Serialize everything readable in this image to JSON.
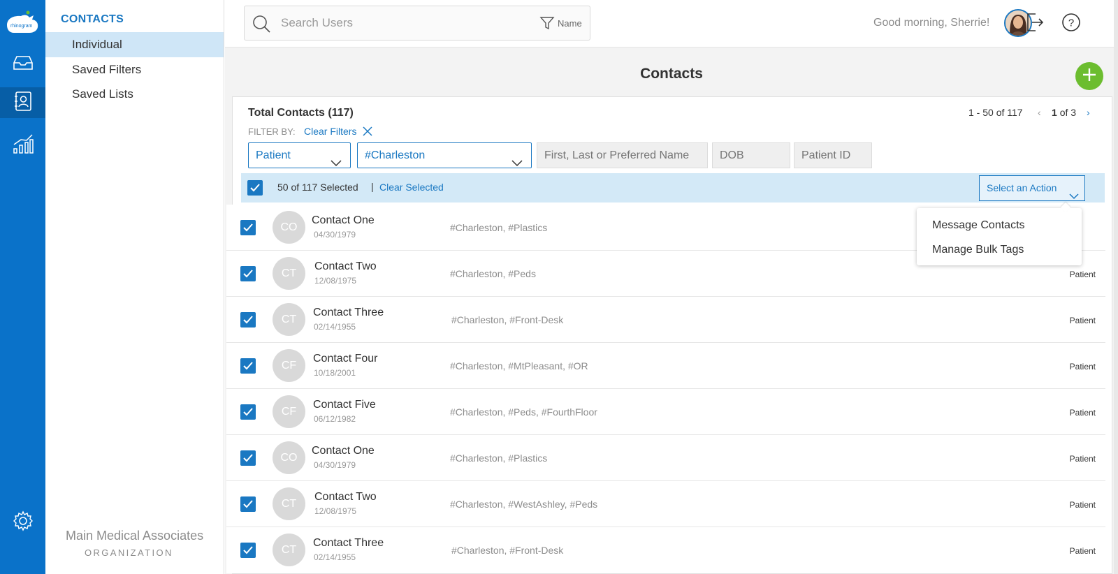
{
  "app": {
    "logo_text": "rhinogram"
  },
  "rail": {
    "items": [
      {
        "icon": "inbox-icon"
      },
      {
        "icon": "contacts-icon"
      },
      {
        "icon": "analytics-icon"
      }
    ],
    "settings_icon": "gear-icon"
  },
  "sidebar": {
    "title": "CONTACTS",
    "items": [
      {
        "label": "Individual",
        "active": true
      },
      {
        "label": "Saved Filters",
        "active": false
      },
      {
        "label": "Saved Lists",
        "active": false
      }
    ],
    "org_name": "Main Medical Associates",
    "org_sub": "ORGANIZATION"
  },
  "header": {
    "search_placeholder": "Search Users",
    "filter_label": "Name",
    "greeting": "Good morning, Sherrie!"
  },
  "main": {
    "title": "Contacts",
    "total_label": "Total Contacts (117)",
    "pager": {
      "range": "1 - 50 of 117",
      "page": "1",
      "of": "of 3"
    },
    "filter_by": "FILTER BY:",
    "clear_filters": "Clear Filters",
    "filters": {
      "type": "Patient",
      "tag": "#Charleston",
      "name_placeholder": "First, Last or Preferred Name",
      "dob_placeholder": "DOB",
      "id_placeholder": "Patient ID"
    },
    "selection": {
      "count": "50 of 117  Selected",
      "separator": "|",
      "clear": "Clear Selected",
      "action": "Select an Action"
    },
    "action_menu": [
      "Message Contacts",
      "Manage Bulk Tags"
    ],
    "rows": [
      {
        "initials": "CO",
        "name": "Contact One",
        "dob": "04/30/1979",
        "tags": "#Charleston, #Plastics",
        "type": ""
      },
      {
        "initials": "CT",
        "name": "Contact Two",
        "dob": "12/08/1975",
        "tags": "#Charleston, #Peds",
        "type": "Patient"
      },
      {
        "initials": "CT",
        "name": "Contact Three",
        "dob": "02/14/1955",
        "tags": "#Charleston, #Front-Desk",
        "type": "Patient"
      },
      {
        "initials": "CF",
        "name": "Contact Four",
        "dob": "10/18/2001",
        "tags": "#Charleston, #MtPleasant, #OR",
        "type": "Patient"
      },
      {
        "initials": "CF",
        "name": "Contact Five",
        "dob": "06/12/1982",
        "tags": "#Charleston, #Peds, #FourthFloor",
        "type": "Patient"
      },
      {
        "initials": "CO",
        "name": "Contact One",
        "dob": "04/30/1979",
        "tags": "#Charleston, #Plastics",
        "type": "Patient"
      },
      {
        "initials": "CT",
        "name": "Contact Two",
        "dob": "12/08/1975",
        "tags": "#Charleston, #WestAshley, #Peds",
        "type": "Patient"
      },
      {
        "initials": "CT",
        "name": "Contact Three",
        "dob": "02/14/1955",
        "tags": "#Charleston, #Front-Desk",
        "type": "Patient"
      }
    ]
  },
  "colors": {
    "brand_blue": "#0a72c9",
    "link_blue": "#1a78c2",
    "add_green": "#6cbd2f",
    "selection_bg": "#d3e9f7"
  }
}
